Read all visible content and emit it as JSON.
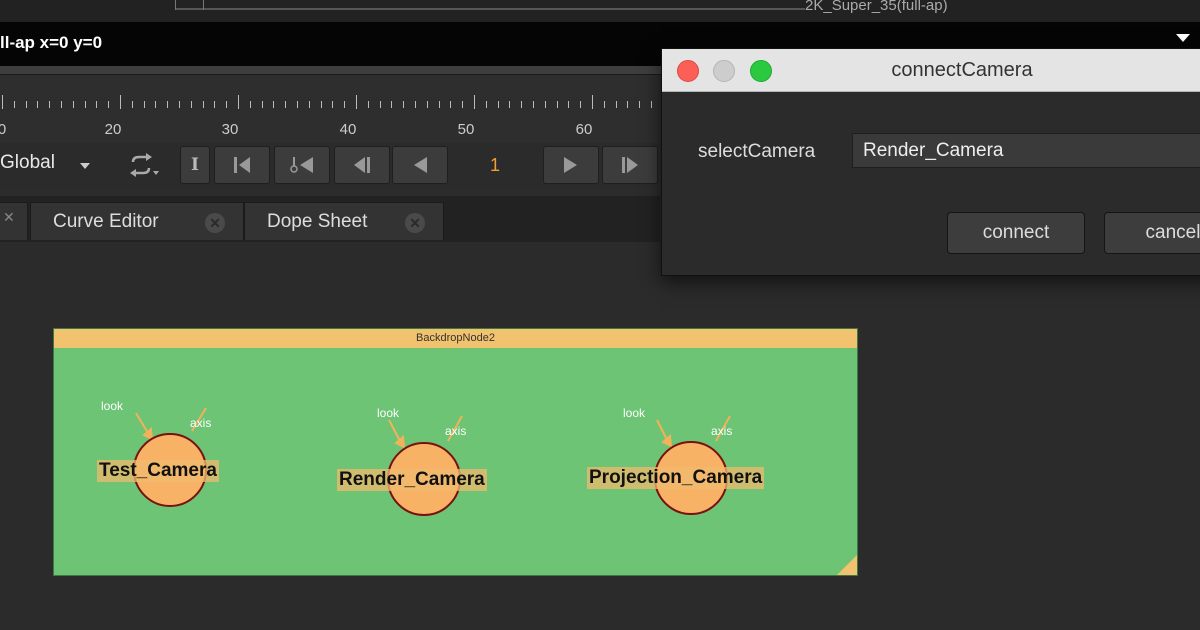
{
  "viewer": {
    "format_label": "2K_Super_35(full-ap)",
    "info_text": "ll-ap  x=0 y=0"
  },
  "timeline": {
    "labels": [
      "0",
      "20",
      "30",
      "40",
      "50",
      "60"
    ]
  },
  "transport": {
    "mode_select": "Global",
    "in_button": "I",
    "frame_value": "1"
  },
  "tabs": [
    {
      "label": "Curve Editor"
    },
    {
      "label": "Dope Sheet"
    }
  ],
  "node_graph": {
    "backdrop": {
      "title": "BackdropNode2",
      "color": "#6cc474",
      "title_color": "#f2c36e"
    },
    "cameras": [
      {
        "name": "Test_Camera",
        "look_label": "look",
        "axis_label": "axis"
      },
      {
        "name": "Render_Camera",
        "look_label": "look",
        "axis_label": "axis"
      },
      {
        "name": "Projection_Camera",
        "look_label": "look",
        "axis_label": "axis"
      }
    ],
    "node_color": "#f7b266"
  },
  "dialog": {
    "title": "connectCamera",
    "select_label": "selectCamera",
    "select_value": "Render_Camera",
    "connect_button": "connect",
    "cancel_button": "cancel"
  },
  "colors": {
    "frame_accent": "#f0a030",
    "close_red": "#fc5f57",
    "minimize_gray": "#c8c8c8",
    "zoom_green": "#2ac940"
  }
}
